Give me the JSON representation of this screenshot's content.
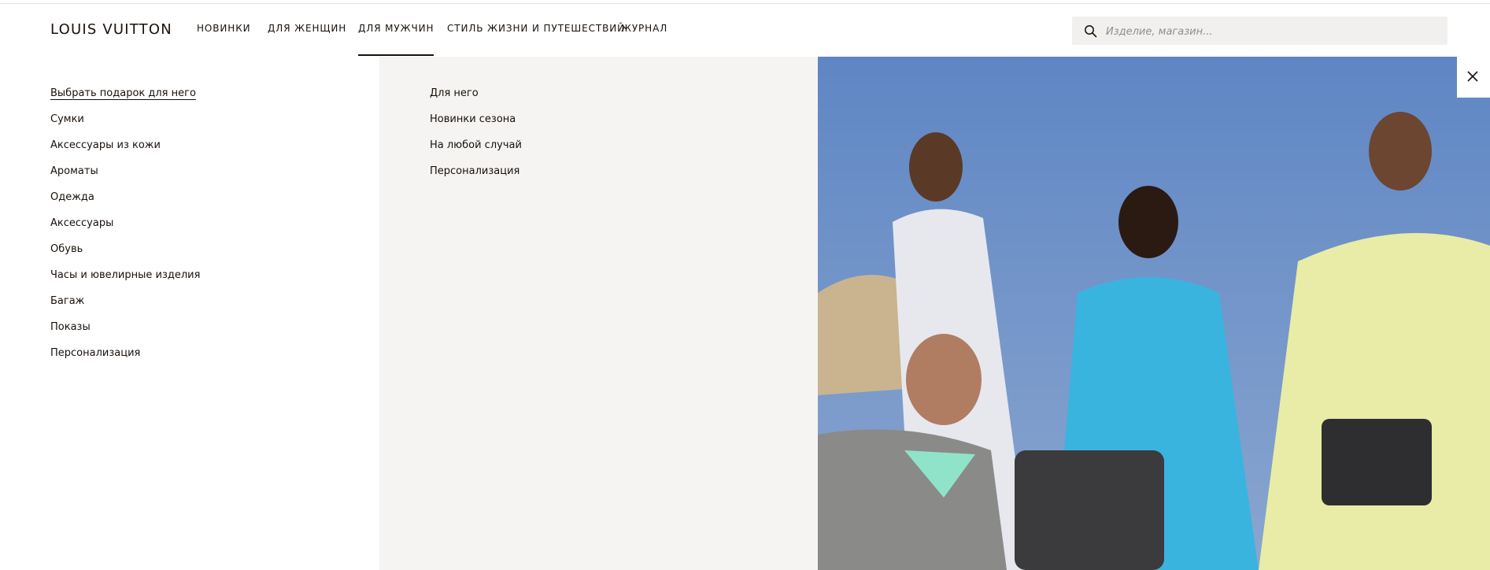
{
  "brand": {
    "logo_text": "LOUIS VUITTON"
  },
  "nav": {
    "items": [
      {
        "label": "НОВИНКИ",
        "active": false
      },
      {
        "label": "ДЛЯ ЖЕНЩИН",
        "active": false
      },
      {
        "label": "ДЛЯ МУЖЧИН",
        "active": true
      },
      {
        "label": "СТИЛЬ ЖИЗНИ И ПУТЕШЕСТВИЙ",
        "active": false
      },
      {
        "label": "ЖУРНАЛ",
        "active": false
      }
    ]
  },
  "search": {
    "placeholder": "Изделие, магазин...",
    "value": "",
    "icon": "search-icon"
  },
  "menu": {
    "primary": [
      "Выбрать подарок для него",
      "Сумки",
      "Аксессуары из кожи",
      "Ароматы",
      "Одежда",
      "Аксессуары",
      "Обувь",
      "Часы и ювелирные изделия",
      "Багаж",
      "Показы",
      "Персонализация"
    ],
    "secondary": [
      "Для него",
      "Новинки сезона",
      "На любой случай",
      "Персонализация"
    ]
  },
  "promo_image": {
    "icon": "photo"
  },
  "close": {
    "icon": "close-icon"
  },
  "colors": {
    "text": "#19110b",
    "mid_panel": "#f5f4f2",
    "search_bg": "#f2f0ee",
    "sky": "#6c90c4"
  }
}
